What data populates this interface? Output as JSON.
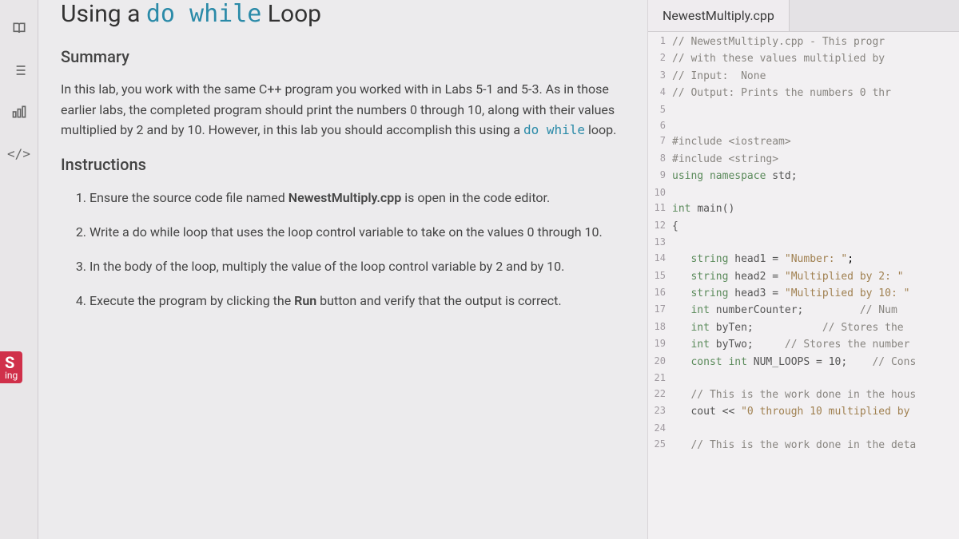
{
  "page": {
    "title_pre": "Using a ",
    "title_kw": "do while",
    "title_post": " Loop"
  },
  "summary": {
    "heading": "Summary",
    "text_pre": "In this lab, you work with the same C++ program you worked with in Labs 5-1 and 5-3. As in those earlier labs, the completed program should print the numbers 0 through 10, along with their values multiplied by 2 and by 10. However, in this lab you should accomplish this using a ",
    "text_kw": "do while",
    "text_post": " loop."
  },
  "instructions": {
    "heading": "Instructions",
    "item1_pre": "Ensure the source code file named ",
    "item1_bold": "NewestMultiply.cpp",
    "item1_post": " is open in the code editor.",
    "item2_pre": "Write a ",
    "item2_kw": "do while",
    "item2_post": " loop that uses the loop control variable to take on the values 0 through 10.",
    "item3": "In the body of the loop, multiply the value of the loop control variable by 2 and by 10.",
    "item4_pre": "Execute the program by clicking the ",
    "item4_bold": "Run",
    "item4_post": " button and verify that the output is correct."
  },
  "editor": {
    "tab": "NewestMultiply.cpp",
    "lines": [
      {
        "n": "1",
        "html": "<span class='tok-comment'>// NewestMultiply.cpp - This progr</span>"
      },
      {
        "n": "2",
        "html": "<span class='tok-comment'>// with these values multiplied by</span>"
      },
      {
        "n": "3",
        "html": "<span class='tok-comment'>// Input:  None</span>"
      },
      {
        "n": "4",
        "html": "<span class='tok-comment'>// Output: Prints the numbers 0 thr</span>"
      },
      {
        "n": "5",
        "html": ""
      },
      {
        "n": "6",
        "html": ""
      },
      {
        "n": "7",
        "html": "<span class='tok-include'>#include &lt;iostream&gt;</span>"
      },
      {
        "n": "8",
        "html": "<span class='tok-include'>#include &lt;string&gt;</span>"
      },
      {
        "n": "9",
        "html": "<span class='tok-keyword'>using namespace</span> <span class='tok-ident'>std;</span>"
      },
      {
        "n": "10",
        "html": ""
      },
      {
        "n": "11",
        "html": "<span class='tok-type'>int</span> <span class='tok-ident'>main()</span>"
      },
      {
        "n": "12",
        "html": "<span class='tok-ident'>{</span>"
      },
      {
        "n": "13",
        "html": ""
      },
      {
        "n": "14",
        "html": "   <span class='tok-type'>string</span> <span class='tok-ident'>head1 =</span> <span class='tok-string'>\"Number: \"</span>;"
      },
      {
        "n": "15",
        "html": "   <span class='tok-type'>string</span> <span class='tok-ident'>head2 =</span> <span class='tok-string'>\"Multiplied by 2: \"</span>"
      },
      {
        "n": "16",
        "html": "   <span class='tok-type'>string</span> <span class='tok-ident'>head3 =</span> <span class='tok-string'>\"Multiplied by 10: \"</span>"
      },
      {
        "n": "17",
        "html": "   <span class='tok-type'>int</span> <span class='tok-ident'>numberCounter;</span>         <span class='tok-comment'>// Num</span>"
      },
      {
        "n": "18",
        "html": "   <span class='tok-type'>int</span> <span class='tok-ident'>byTen;</span>           <span class='tok-comment'>// Stores the</span>"
      },
      {
        "n": "19",
        "html": "   <span class='tok-type'>int</span> <span class='tok-ident'>byTwo;</span>     <span class='tok-comment'>// Stores the number</span>"
      },
      {
        "n": "20",
        "html": "   <span class='tok-keyword'>const</span> <span class='tok-type'>int</span> <span class='tok-ident'>NUM_LOOPS =</span> <span class='tok-ident'>10;</span>    <span class='tok-comment'>// Cons</span>"
      },
      {
        "n": "21",
        "html": ""
      },
      {
        "n": "22",
        "html": "   <span class='tok-comment'>// This is the work done in the hous</span>"
      },
      {
        "n": "23",
        "html": "   <span class='tok-ident'>cout &lt;&lt;</span> <span class='tok-string'>\"0 through 10 multiplied by</span>"
      },
      {
        "n": "24",
        "html": ""
      },
      {
        "n": "25",
        "html": "   <span class='tok-comment'>// This is the work done in the deta</span>"
      }
    ]
  },
  "badge": {
    "top": "S",
    "sub": "ing"
  }
}
